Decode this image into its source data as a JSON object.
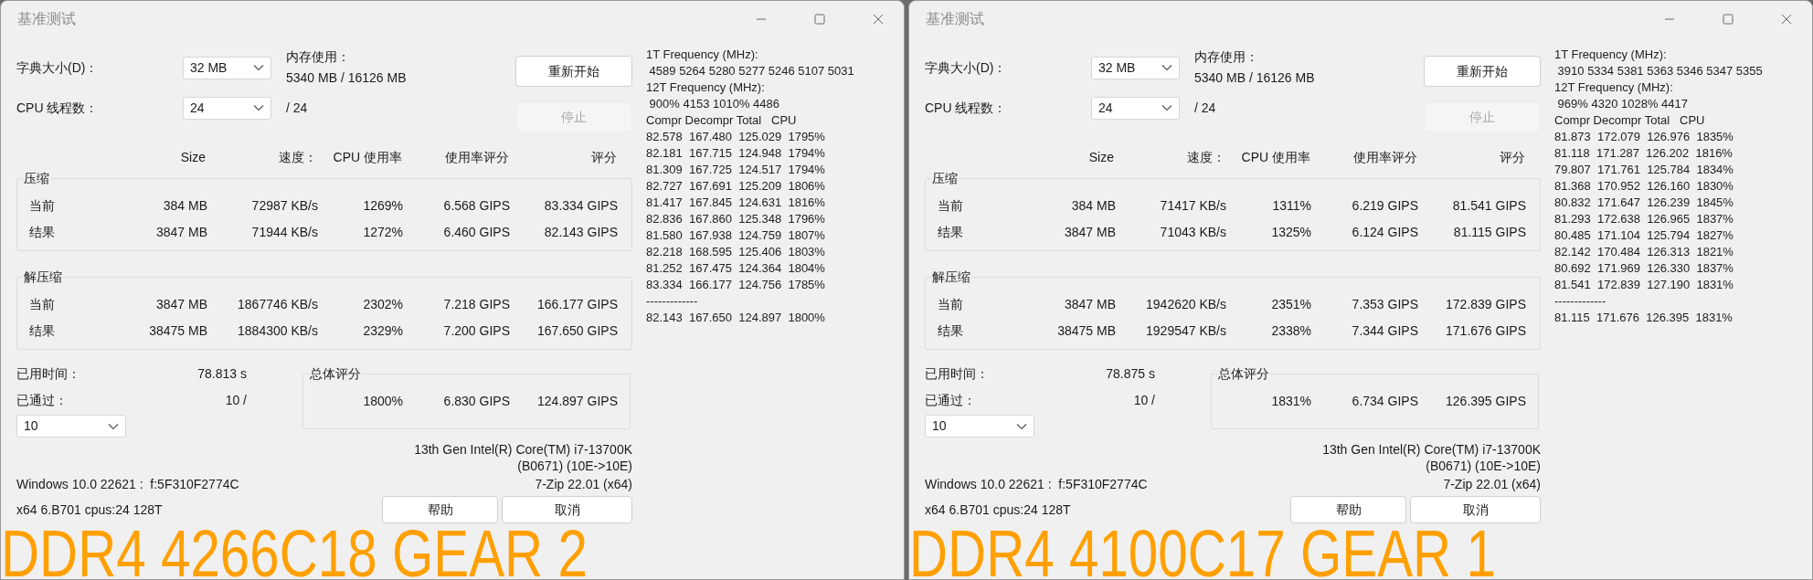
{
  "windows": [
    {
      "title": "基准测试",
      "dictionary": {
        "label": "字典大小(D)：",
        "value": "32 MB"
      },
      "memory": {
        "label": "内存使用：",
        "value": "5340 MB / 16126 MB"
      },
      "threads": {
        "label": "CPU 线程数：",
        "value": "24",
        "total": "/ 24"
      },
      "buttons": [
        {
          "label": "重新开始",
          "disabled": false
        },
        {
          "label": "停止",
          "disabled": true
        }
      ],
      "table": {
        "columns": [
          "Size",
          "速度：",
          "CPU 使用率",
          "使用率评分",
          "评分"
        ],
        "groups": [
          {
            "title": "压缩",
            "rows": [
              {
                "label": "当前",
                "cells": [
                  "384 MB",
                  "72987 KB/s",
                  "1269%",
                  "6.568 GIPS",
                  "83.334 GIPS"
                ]
              },
              {
                "label": "结果",
                "cells": [
                  "3847 MB",
                  "71944 KB/s",
                  "1272%",
                  "6.460 GIPS",
                  "82.143 GIPS"
                ]
              }
            ]
          },
          {
            "title": "解压缩",
            "rows": [
              {
                "label": "当前",
                "cells": [
                  "3847 MB",
                  "1867746 KB/s",
                  "2302%",
                  "7.218 GIPS",
                  "166.177 GIPS"
                ]
              },
              {
                "label": "结果",
                "cells": [
                  "38475 MB",
                  "1884300 KB/s",
                  "2329%",
                  "7.200 GIPS",
                  "167.650 GIPS"
                ]
              }
            ]
          }
        ]
      },
      "elapsed": {
        "label": "已用时间：",
        "value": "78.813 s"
      },
      "passes": {
        "label": "已通过：",
        "value": "10 /",
        "select": "10"
      },
      "total": {
        "title": "总体评分",
        "values": [
          "1800%",
          "6.830 GIPS",
          "124.897 GIPS"
        ]
      },
      "cpu_lines": [
        "13th Gen Intel(R) Core(TM) i7-13700K",
        "(B0671) (10E->10E)"
      ],
      "os_line": "Windows 10.0 22621 :  f:5F310F2774C",
      "version": "7-Zip 22.01 (x64)",
      "cpu_id": "x64 6.B701 cpus:24 128T",
      "footer_buttons": [
        "帮助",
        "取消"
      ],
      "log": [
        "1T Frequency (MHz):",
        " 4589 5264 5280 5277 5246 5107 5031",
        "12T Frequency (MHz):",
        " 900% 4153 1010% 4486",
        "Compr Decompr Total   CPU",
        "82.578  167.480  125.029  1795%",
        "82.181  167.715  124.948  1794%",
        "81.309  167.725  124.517  1794%",
        "82.727  167.691  125.209  1806%",
        "81.417  167.845  124.631  1816%",
        "82.836  167.860  125.348  1796%",
        "81.580  167.938  124.759  1807%",
        "82.218  168.595  125.406  1803%",
        "81.252  167.475  124.364  1804%",
        "83.334  166.177  124.756  1785%",
        "-------------",
        "82.143  167.650  124.897  1800%"
      ],
      "caption": "DDR4 4266C18 GEAR 2"
    },
    {
      "title": "基准测试",
      "dictionary": {
        "label": "字典大小(D)：",
        "value": "32 MB"
      },
      "memory": {
        "label": "内存使用：",
        "value": "5340 MB / 16126 MB"
      },
      "threads": {
        "label": "CPU 线程数：",
        "value": "24",
        "total": "/ 24"
      },
      "buttons": [
        {
          "label": "重新开始",
          "disabled": false
        },
        {
          "label": "停止",
          "disabled": true
        }
      ],
      "table": {
        "columns": [
          "Size",
          "速度：",
          "CPU 使用率",
          "使用率评分",
          "评分"
        ],
        "groups": [
          {
            "title": "压缩",
            "rows": [
              {
                "label": "当前",
                "cells": [
                  "384 MB",
                  "71417 KB/s",
                  "1311%",
                  "6.219 GIPS",
                  "81.541 GIPS"
                ]
              },
              {
                "label": "结果",
                "cells": [
                  "3847 MB",
                  "71043 KB/s",
                  "1325%",
                  "6.124 GIPS",
                  "81.115 GIPS"
                ]
              }
            ]
          },
          {
            "title": "解压缩",
            "rows": [
              {
                "label": "当前",
                "cells": [
                  "3847 MB",
                  "1942620 KB/s",
                  "2351%",
                  "7.353 GIPS",
                  "172.839 GIPS"
                ]
              },
              {
                "label": "结果",
                "cells": [
                  "38475 MB",
                  "1929547 KB/s",
                  "2338%",
                  "7.344 GIPS",
                  "171.676 GIPS"
                ]
              }
            ]
          }
        ]
      },
      "elapsed": {
        "label": "已用时间：",
        "value": "78.875 s"
      },
      "passes": {
        "label": "已通过：",
        "value": "10 /",
        "select": "10"
      },
      "total": {
        "title": "总体评分",
        "values": [
          "1831%",
          "6.734 GIPS",
          "126.395 GIPS"
        ]
      },
      "cpu_lines": [
        "13th Gen Intel(R) Core(TM) i7-13700K",
        "(B0671) (10E->10E)"
      ],
      "os_line": "Windows 10.0 22621 :  f:5F310F2774C",
      "version": "7-Zip 22.01 (x64)",
      "cpu_id": "x64 6.B701 cpus:24 128T",
      "footer_buttons": [
        "帮助",
        "取消"
      ],
      "log": [
        "1T Frequency (MHz):",
        " 3910 5334 5381 5363 5346 5347 5355",
        "12T Frequency (MHz):",
        " 969% 4320 1028% 4417",
        "Compr Decompr Total   CPU",
        "81.873  172.079  126.976  1835%",
        "81.118  171.287  126.202  1816%",
        "79.807  171.761  125.784  1834%",
        "81.368  170.952  126.160  1830%",
        "80.832  171.647  126.239  1845%",
        "81.293  172.638  126.965  1837%",
        "80.485  171.104  125.794  1827%",
        "82.142  170.484  126.313  1821%",
        "80.692  171.969  126.330  1837%",
        "81.541  172.839  127.190  1831%",
        "-------------",
        "81.115  171.676  126.395  1831%"
      ],
      "caption": "DDR4 4100C17 GEAR 1"
    }
  ]
}
